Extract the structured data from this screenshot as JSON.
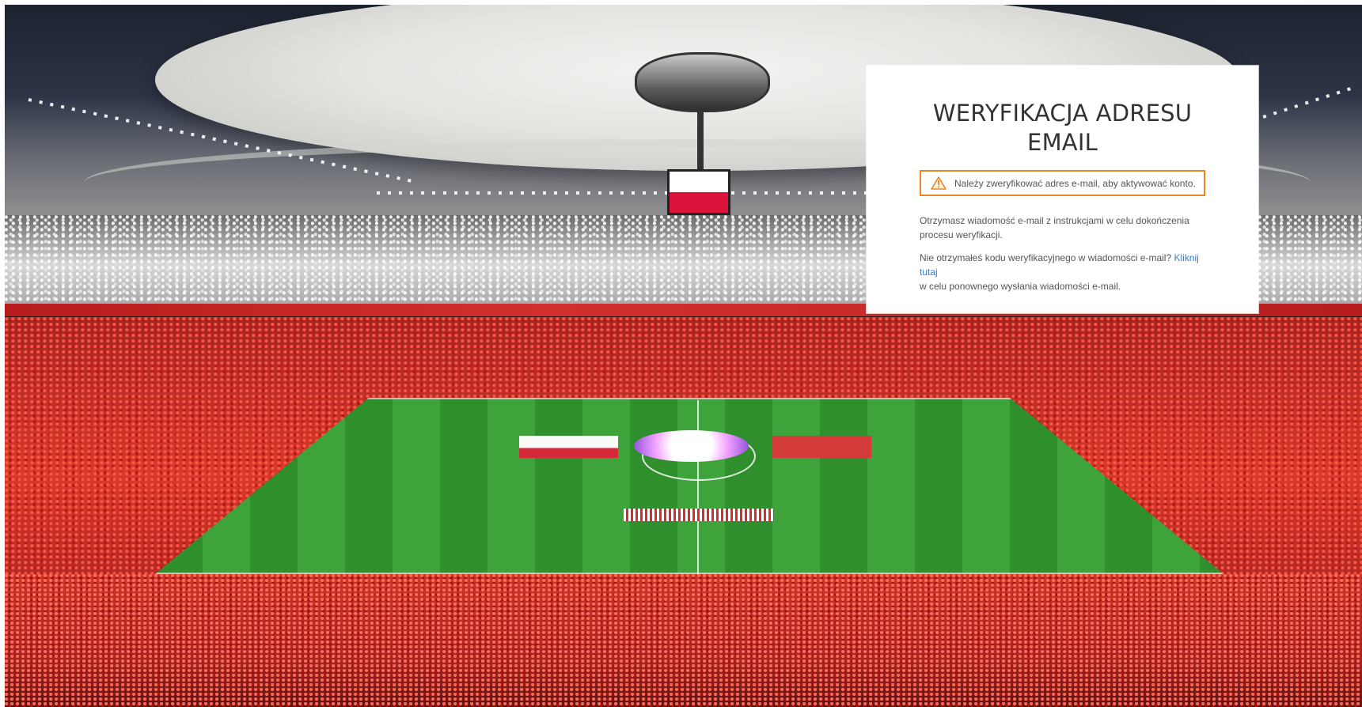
{
  "verification": {
    "title_line_1": "WERYFIKACJA ADRESU",
    "title_line_2": "EMAIL",
    "warning": "Należy zweryfikować adres e-mail, aby aktywować konto.",
    "info_line_1": "Otrzymasz wiadomość e-mail z instrukcjami w celu dokończenia",
    "info_line_2": "procesu weryfikacji.",
    "resend_prefix": "Nie otrzymałeś kodu weryfikacyjnego w wiadomości e-mail?",
    "resend_link": "Kliknij tutaj",
    "resend_suffix": "w celu ponownego wysłania wiadomości e-mail."
  },
  "colors": {
    "warning_border": "#e98522",
    "link": "#2f80c9",
    "title": "#333333"
  },
  "icons": {
    "warning": "warning-triangle-icon"
  }
}
